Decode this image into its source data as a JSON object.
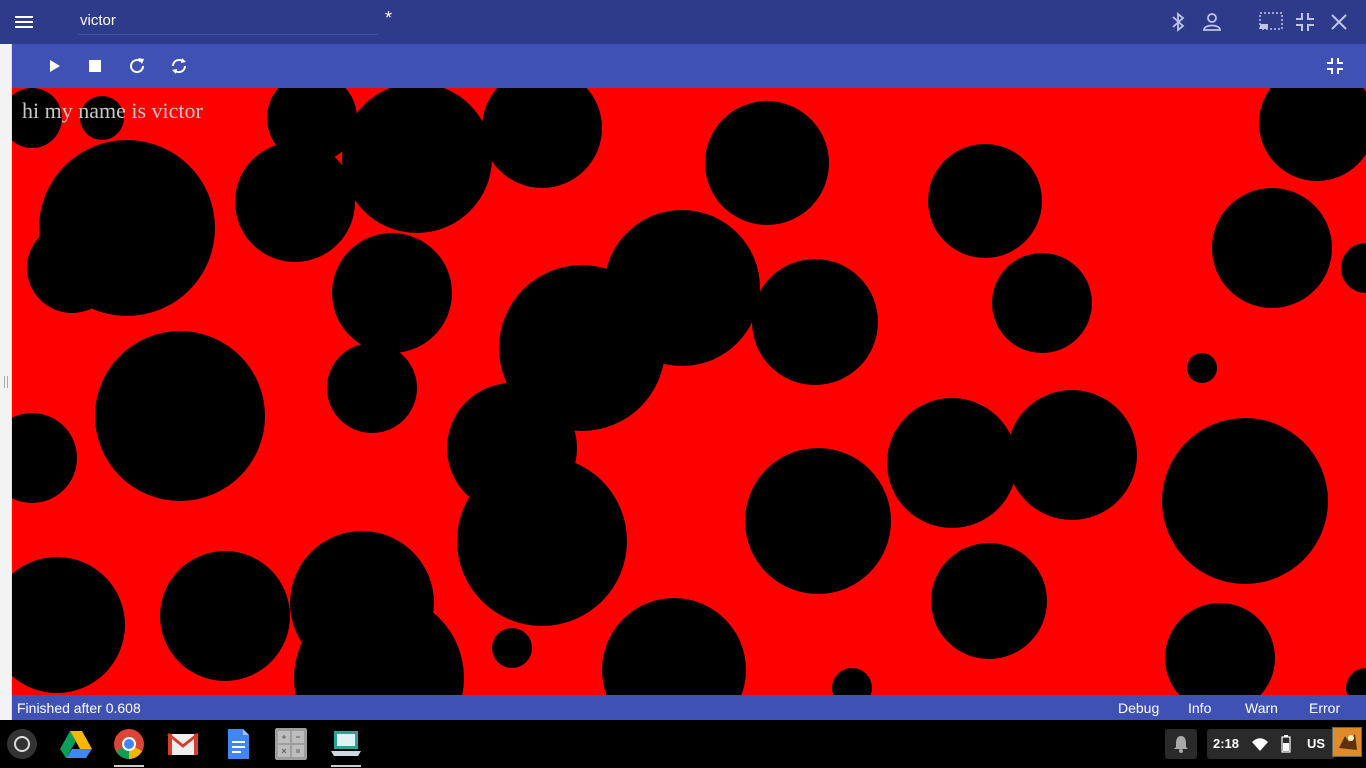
{
  "titlebar": {
    "title": "victor",
    "modified_marker": "*"
  },
  "toolbar": {
    "buttons": [
      "play",
      "stop",
      "reload",
      "sync",
      "exit-fullscreen"
    ]
  },
  "canvas": {
    "output_text": "hi my name is victor",
    "background_color": "#ff0000",
    "circle_color": "#000000"
  },
  "status": {
    "text": "Finished after 0.608",
    "levels": [
      "Debug",
      "Info",
      "Warn",
      "Error"
    ]
  },
  "shelf": {
    "apps": [
      "google-drive-icon",
      "chrome-icon",
      "gmail-icon",
      "google-docs-icon",
      "calculator-icon",
      "chromebook-app-icon"
    ],
    "time": "2:18",
    "keyboard_layout": "US"
  }
}
